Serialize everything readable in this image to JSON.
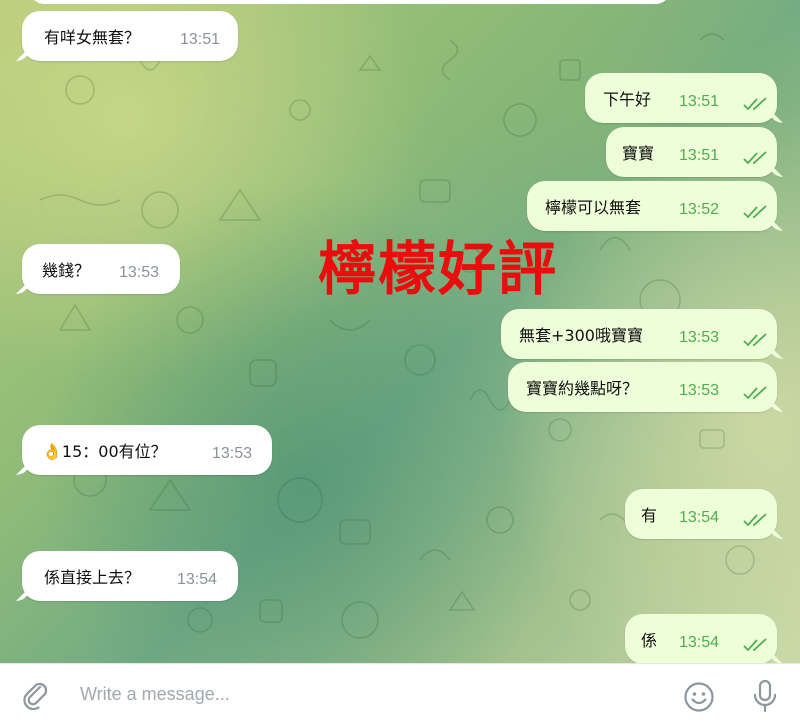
{
  "chat": {
    "messages": [
      {
        "direction": "in",
        "text": "有咩女無套？",
        "time": "13:51"
      },
      {
        "direction": "out",
        "text": "下午好",
        "time": "13:51",
        "status": "read-double-check-icon"
      },
      {
        "direction": "out",
        "text": "寶寶",
        "time": "13:51",
        "status": "read-double-check-icon"
      },
      {
        "direction": "out",
        "text": "檸檬可以無套",
        "time": "13:52",
        "status": "read-double-check-icon"
      },
      {
        "direction": "in",
        "text": "幾錢？",
        "time": "13:53"
      },
      {
        "direction": "out",
        "text": "無套+300哦寶寶",
        "time": "13:53",
        "status": "read-double-check-icon"
      },
      {
        "direction": "out",
        "text": "寶寶約幾點呀？",
        "time": "13:53",
        "status": "read-double-check-icon"
      },
      {
        "direction": "in",
        "text": "👌15：00有位？",
        "time": "13:53"
      },
      {
        "direction": "out",
        "text": "有",
        "time": "13:54",
        "status": "read-double-check-icon"
      },
      {
        "direction": "in",
        "text": "係直接上去？",
        "time": "13:54"
      },
      {
        "direction": "out",
        "text": "係",
        "time": "13:54",
        "status": "read-double-check-icon"
      }
    ]
  },
  "overlay": {
    "caption": "檸檬好評"
  },
  "composer": {
    "placeholder": "Write a message...",
    "icons": {
      "attach": "paperclip-icon",
      "emoji": "smiley-icon",
      "voice": "microphone-icon"
    }
  },
  "colors": {
    "incoming_bubble": "#ffffff",
    "outgoing_bubble": "#eefed9",
    "outgoing_time": "#4fae4e",
    "incoming_time": "#8c9299",
    "overlay_caption": "#ea0d0d",
    "accent": "#4fae4e"
  }
}
